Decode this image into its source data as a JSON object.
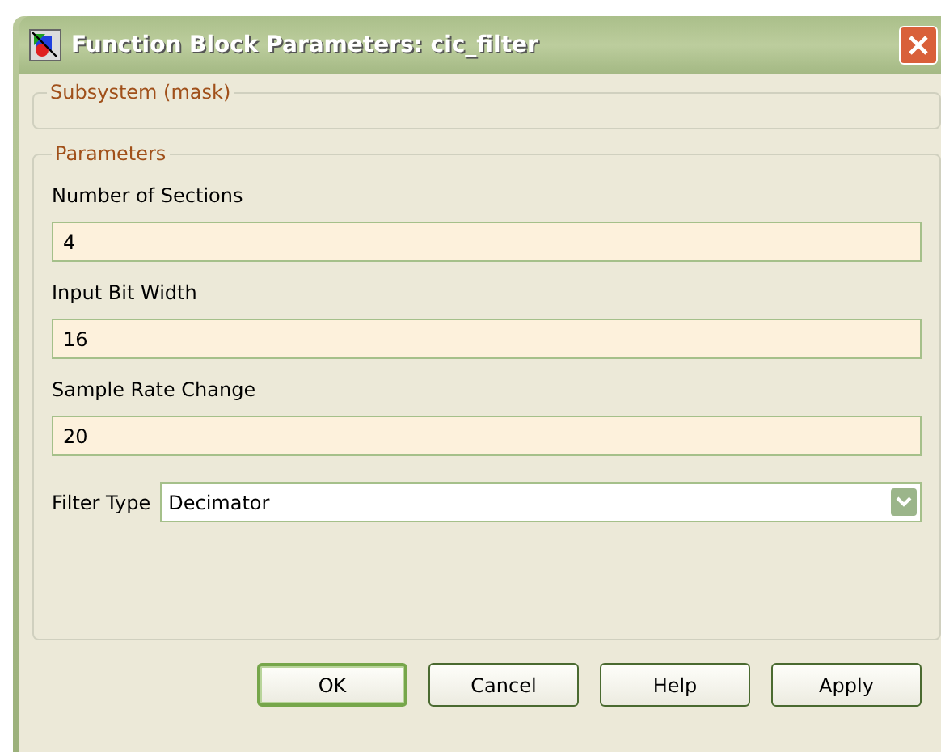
{
  "window": {
    "title": "Function Block Parameters: cic_filter"
  },
  "subsystem": {
    "legend": "Subsystem (mask)"
  },
  "parameters": {
    "legend": "Parameters",
    "fields": [
      {
        "label": "Number of Sections",
        "value": "4"
      },
      {
        "label": "Input Bit Width",
        "value": "16"
      },
      {
        "label": "Sample Rate Change",
        "value": "20"
      }
    ],
    "filter_type": {
      "label": "Filter Type",
      "value": "Decimator"
    }
  },
  "buttons": [
    {
      "label": "OK",
      "default": true
    },
    {
      "label": "Cancel",
      "default": false
    },
    {
      "label": "Help",
      "default": false
    },
    {
      "label": "Apply",
      "default": false
    }
  ]
}
